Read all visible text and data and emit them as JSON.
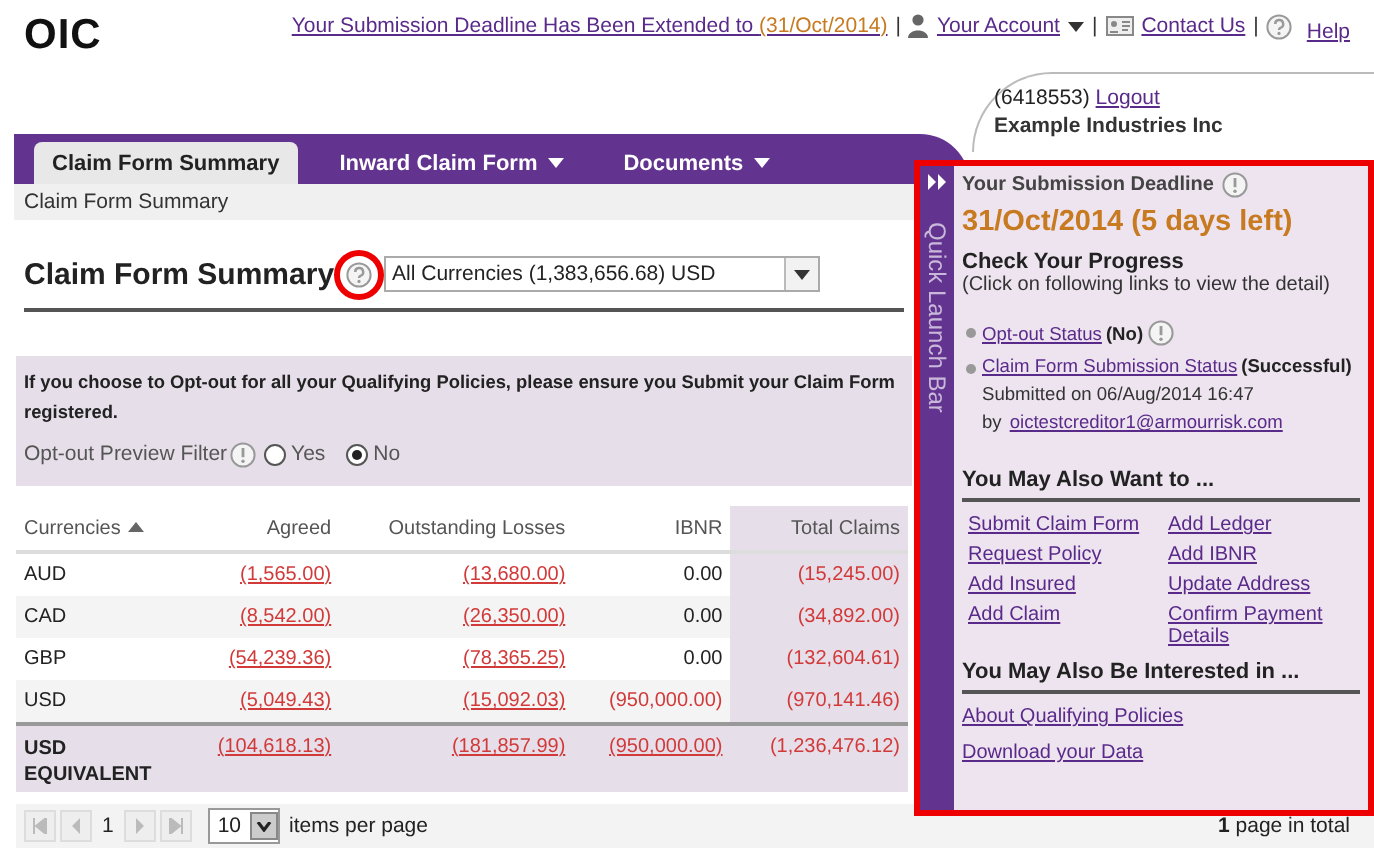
{
  "header": {
    "logo": "OIC",
    "notice_link": "Your Submission Deadline Has Been Extended to ",
    "notice_date": "(31/Oct/2014)",
    "separator": "|",
    "account_link": "Your Account",
    "contact_link": "Contact Us",
    "help_link": "Help"
  },
  "account": {
    "id": "(6418553)",
    "logout": "Logout",
    "company": "Example Industries Inc"
  },
  "tabs": [
    {
      "label": "Claim Form Summary",
      "selected": true,
      "dropdown": false
    },
    {
      "label": "Inward Claim Form",
      "selected": false,
      "dropdown": true
    },
    {
      "label": "Documents",
      "selected": false,
      "dropdown": true
    }
  ],
  "breadcrumb": "Claim Form Summary",
  "page_title": "Claim Form Summary",
  "currency_select": {
    "value": "All Currencies (1,383,656.68) USD"
  },
  "notice": {
    "text": "If you choose to Opt-out for all your Qualifying Policies, please ensure you Submit your Claim Form",
    "text_end": "registered.",
    "filter_label": "Opt-out Preview Filter",
    "options": [
      {
        "label": "Yes",
        "selected": false
      },
      {
        "label": "No",
        "selected": true
      }
    ]
  },
  "table": {
    "columns": [
      {
        "label": "Currencies",
        "sorted": true,
        "highlighted": false
      },
      {
        "label": "Agreed",
        "sorted": false,
        "highlighted": false
      },
      {
        "label": "Outstanding Losses",
        "sorted": false,
        "highlighted": false
      },
      {
        "label": "IBNR",
        "sorted": false,
        "highlighted": false
      },
      {
        "label": "Total Claims",
        "sorted": false,
        "highlighted": true
      }
    ],
    "rows": [
      {
        "kind": "data",
        "cells": [
          {
            "text": "AUD",
            "link": false,
            "negative": false
          },
          {
            "text": "(1,565.00)",
            "link": true,
            "negative": true
          },
          {
            "text": "(13,680.00)",
            "link": true,
            "negative": true
          },
          {
            "text": "0.00",
            "link": false,
            "negative": false
          },
          {
            "text": "(15,245.00)",
            "link": false,
            "negative": true
          }
        ]
      },
      {
        "kind": "data",
        "cells": [
          {
            "text": "CAD",
            "link": false,
            "negative": false
          },
          {
            "text": "(8,542.00)",
            "link": true,
            "negative": true
          },
          {
            "text": "(26,350.00)",
            "link": true,
            "negative": true
          },
          {
            "text": "0.00",
            "link": false,
            "negative": false
          },
          {
            "text": "(34,892.00)",
            "link": false,
            "negative": true
          }
        ]
      },
      {
        "kind": "data",
        "cells": [
          {
            "text": "GBP",
            "link": false,
            "negative": false
          },
          {
            "text": "(54,239.36)",
            "link": true,
            "negative": true
          },
          {
            "text": "(78,365.25)",
            "link": true,
            "negative": true
          },
          {
            "text": "0.00",
            "link": false,
            "negative": false
          },
          {
            "text": "(132,604.61)",
            "link": false,
            "negative": true
          }
        ]
      },
      {
        "kind": "data",
        "cells": [
          {
            "text": "USD",
            "link": false,
            "negative": false
          },
          {
            "text": "(5,049.43)",
            "link": true,
            "negative": true
          },
          {
            "text": "(15,092.03)",
            "link": true,
            "negative": true
          },
          {
            "text": "(950,000.00)",
            "link": false,
            "negative": true
          },
          {
            "text": "(970,141.46)",
            "link": false,
            "negative": true
          }
        ]
      },
      {
        "kind": "total",
        "cells": [
          {
            "text": "USD EQUIVALENT",
            "link": false,
            "negative": false
          },
          {
            "text": "(104,618.13)",
            "link": true,
            "negative": true
          },
          {
            "text": "(181,857.99)",
            "link": true,
            "negative": true
          },
          {
            "text": "(950,000.00)",
            "link": true,
            "negative": true
          },
          {
            "text": "(1,236,476.12)",
            "link": false,
            "negative": true
          }
        ]
      }
    ]
  },
  "pager": {
    "page": "1",
    "page_size": "10",
    "page_size_label": "items per page",
    "total": "**1** page in total"
  },
  "quick_launch": {
    "bar_label": "Quick Launch Bar",
    "deadline_title": "Your Submission Deadline",
    "deadline": "31/Oct/2014 (5 days left)",
    "progress_title": "Check Your Progress",
    "progress_hint": "(Click on following links to view the detail)",
    "progress": [
      {
        "link": "Opt-out Status",
        "status": "(No)",
        "info": true
      },
      {
        "link": "Claim Form Submission Status",
        "status": "(Successful)",
        "info": false,
        "detail": "Submitted on 06/Aug/2014 16:47",
        "by": "by",
        "by_link": "oictestcreditor1@armourrisk.com"
      }
    ],
    "want_title": "You May Also Want to ...",
    "want_links": [
      "Submit Claim Form",
      "Add Ledger",
      "Request Policy",
      "Add IBNR",
      "Add Insured",
      "Update Address",
      "Add Claim",
      "Confirm Payment Details"
    ],
    "interest_title": "You May Also Be Interested in ...",
    "interest_links": [
      "About Qualifying Policies",
      "Download your Data"
    ]
  }
}
